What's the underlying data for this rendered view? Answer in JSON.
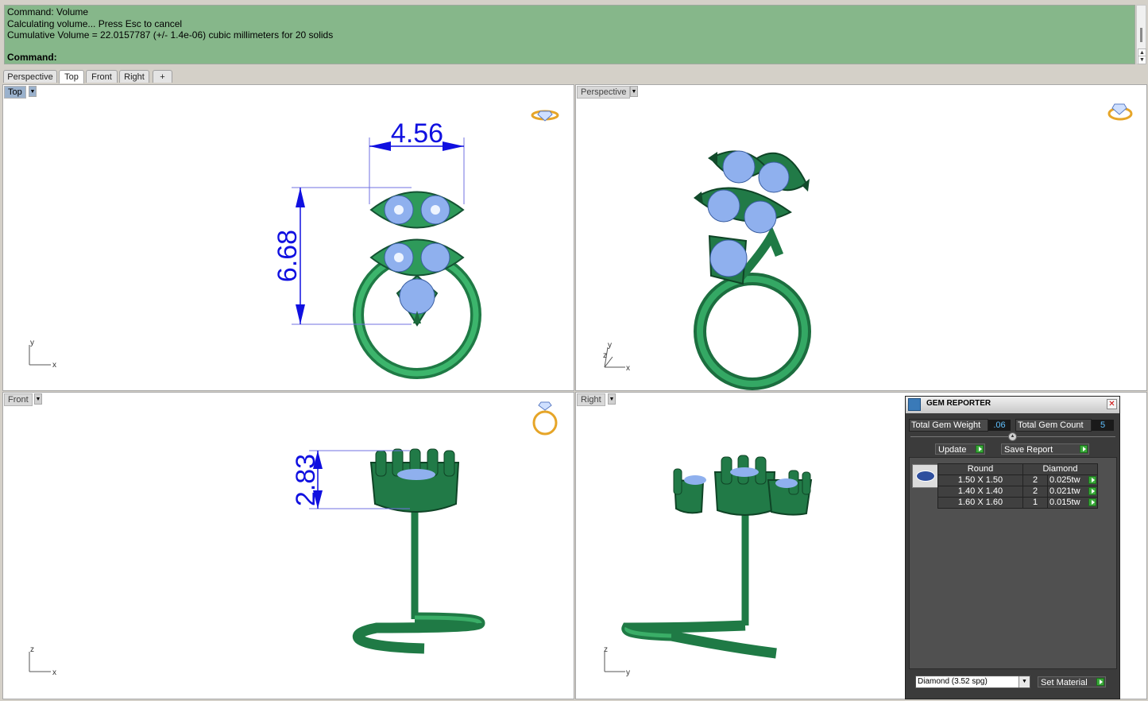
{
  "command_history": {
    "lines": [
      "Command: Volume",
      "Calculating volume... Press Esc to cancel",
      "Cumulative Volume = 22.0157787 (+/- 1.4e-06) cubic millimeters for 20 solids"
    ],
    "prompt": "Command:"
  },
  "tabs": [
    {
      "label": "Perspective"
    },
    {
      "label": "Top"
    },
    {
      "label": "Front"
    },
    {
      "label": "Right"
    },
    {
      "label": "+"
    }
  ],
  "viewports": {
    "top": {
      "label": "Top",
      "dim_width": "4.56",
      "dim_height": "6.68",
      "axis_h": "x",
      "axis_v": "y"
    },
    "perspective": {
      "label": "Perspective",
      "axis_h": "x",
      "axis_v": "y",
      "axis_z": "z"
    },
    "front": {
      "label": "Front",
      "dim_height": "2.83",
      "axis_h": "x",
      "axis_v": "z"
    },
    "right": {
      "label": "Right",
      "axis_h": "y",
      "axis_v": "z"
    }
  },
  "gem_reporter": {
    "title": "GEM REPORTER",
    "total_weight_label": "Total Gem Weight",
    "total_weight_value": ".06",
    "total_count_label": "Total Gem Count",
    "total_count_value": "5",
    "update_label": "Update",
    "save_report_label": "Save Report",
    "table": {
      "header_shape": "Round",
      "header_material": "Diamond",
      "rows": [
        {
          "size": "1.50 X 1.50",
          "count": "2",
          "weight": "0.025tw"
        },
        {
          "size": "1.40 X 1.40",
          "count": "2",
          "weight": "0.021tw"
        },
        {
          "size": "1.60 X 1.60",
          "count": "1",
          "weight": "0.015tw"
        }
      ]
    },
    "material_select": "Diamond    (3.52 spg)",
    "set_material_label": "Set Material"
  },
  "colors": {
    "command_bg": "#86b78a",
    "metal": "#2e9a5a",
    "gem": "#8fb0ee",
    "dimension": "#1010e0",
    "active_viewport": "#9ab1cc"
  }
}
